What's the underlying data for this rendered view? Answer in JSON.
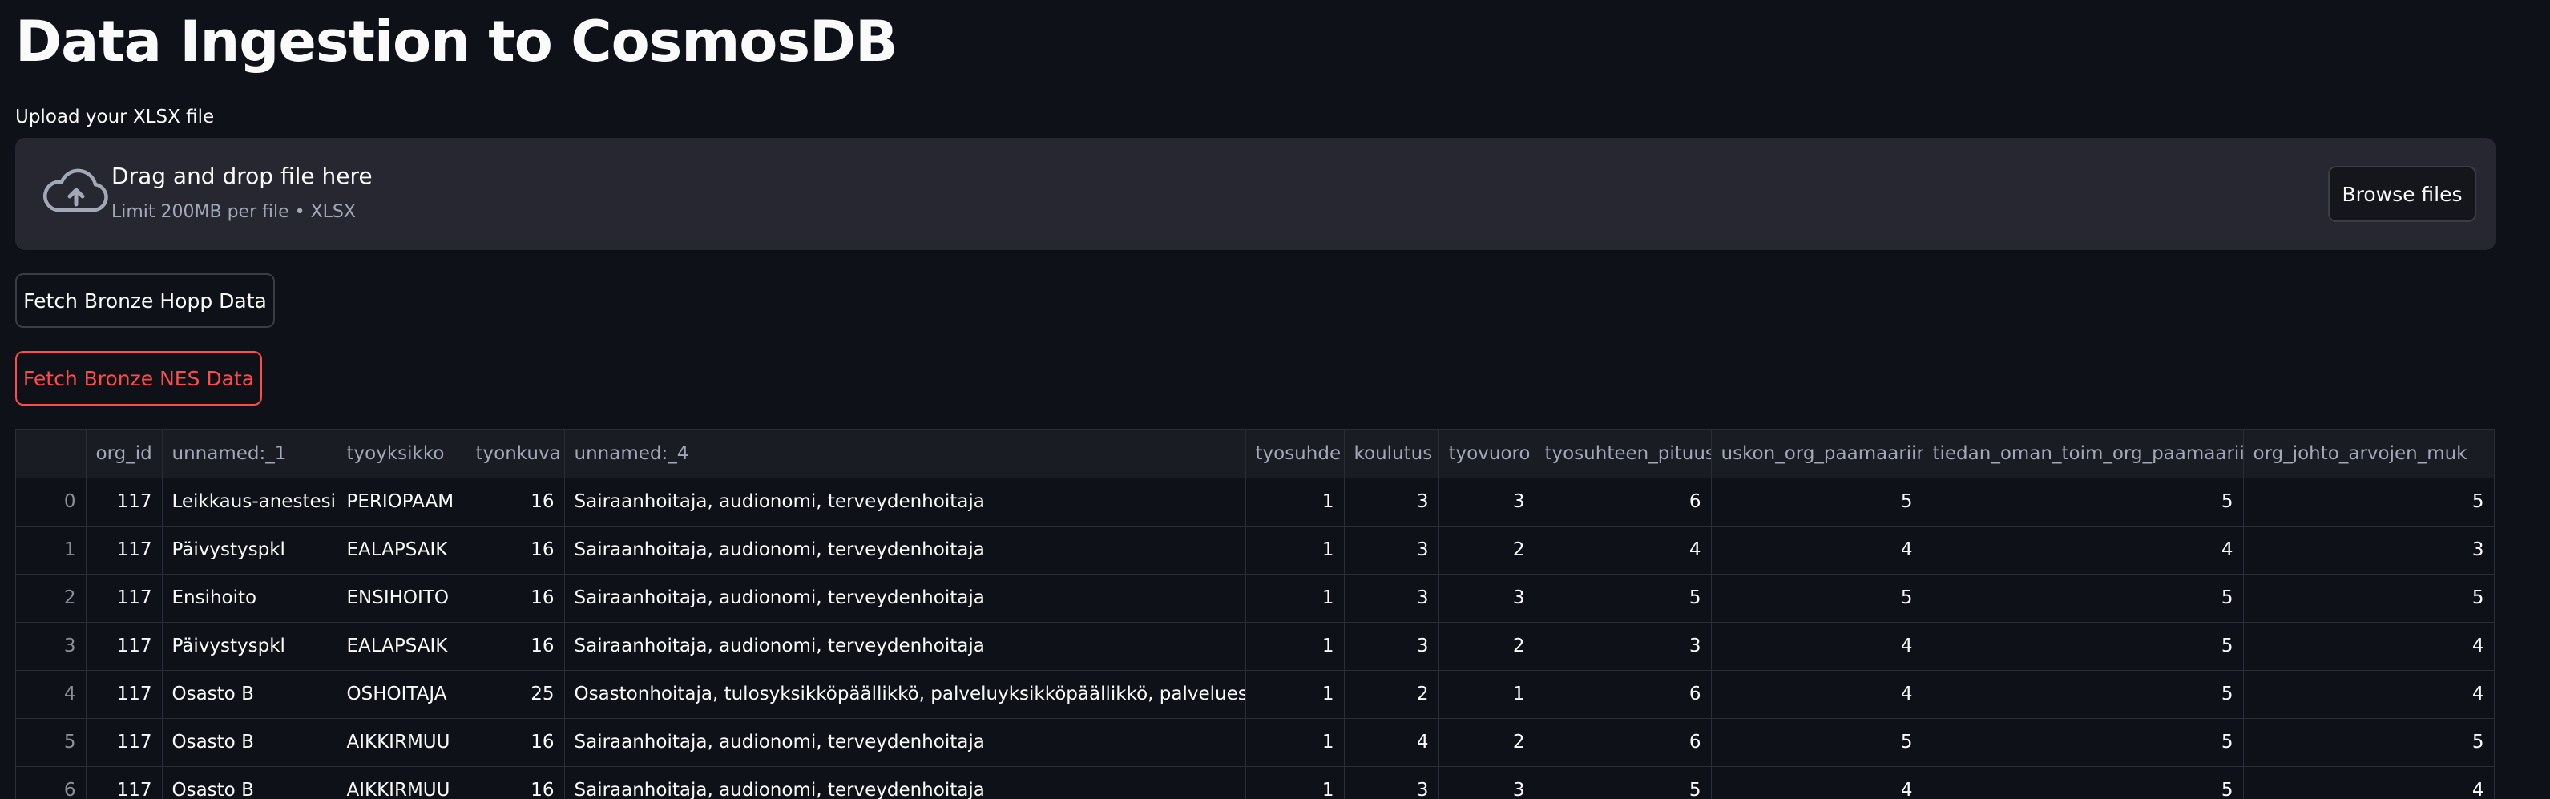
{
  "page": {
    "title": "Data Ingestion to CosmosDB"
  },
  "uploader": {
    "label": "Upload your XLSX file",
    "drop_title": "Drag and drop file here",
    "drop_subtitle": "Limit 200MB per file • XLSX",
    "browse_label": "Browse files",
    "icon": "cloud-upload-icon"
  },
  "buttons": {
    "fetch_hopp": "Fetch Bronze Hopp Data",
    "fetch_nes": "Fetch Bronze NES Data"
  },
  "colors": {
    "background": "#0e1117",
    "panel": "#262730",
    "accent_red": "#ff4b4b",
    "muted_text": "#a3a8b8"
  },
  "table": {
    "columns": [
      "",
      "org_id",
      "unnamed:_1",
      "tyoyksikko",
      "tyonkuva",
      "unnamed:_4",
      "tyosuhde",
      "koulutus",
      "tyovuoro",
      "tyosuhteen_pituus",
      "uskon_org_paamaariin",
      "tiedan_oman_toim_org_paamaariin",
      "org_johto_arvojen_muk"
    ],
    "rows": [
      [
        "0",
        "117",
        "Leikkaus-anestesia",
        "PERIOPAAM",
        "16",
        "Sairaanhoitaja, audionomi, terveydenhoitaja",
        "1",
        "3",
        "3",
        "6",
        "5",
        "5",
        "5"
      ],
      [
        "1",
        "117",
        "Päivystyspkl",
        "EALAPSAIK",
        "16",
        "Sairaanhoitaja, audionomi, terveydenhoitaja",
        "1",
        "3",
        "2",
        "4",
        "4",
        "4",
        "3"
      ],
      [
        "2",
        "117",
        "Ensihoito",
        "ENSIHOITO",
        "16",
        "Sairaanhoitaja, audionomi, terveydenhoitaja",
        "1",
        "3",
        "3",
        "5",
        "5",
        "5",
        "5"
      ],
      [
        "3",
        "117",
        "Päivystyspkl",
        "EALAPSAIK",
        "16",
        "Sairaanhoitaja, audionomi, terveydenhoitaja",
        "1",
        "3",
        "2",
        "3",
        "4",
        "5",
        "4"
      ],
      [
        "4",
        "117",
        "Osasto B",
        "OSHOITAJA",
        "25",
        "Osastonhoitaja, tulosyksikköpäällikkö, palveluyksikköpäällikkö, palveluesihenkilö",
        "1",
        "2",
        "1",
        "6",
        "4",
        "5",
        "4"
      ],
      [
        "5",
        "117",
        "Osasto B",
        "AIKKIRMUU",
        "16",
        "Sairaanhoitaja, audionomi, terveydenhoitaja",
        "1",
        "4",
        "2",
        "6",
        "5",
        "5",
        "5"
      ],
      [
        "6",
        "117",
        "Osasto B",
        "AIKKIRMUU",
        "16",
        "Sairaanhoitaja, audionomi, terveydenhoitaja",
        "1",
        "3",
        "3",
        "5",
        "4",
        "5",
        "4"
      ]
    ]
  }
}
